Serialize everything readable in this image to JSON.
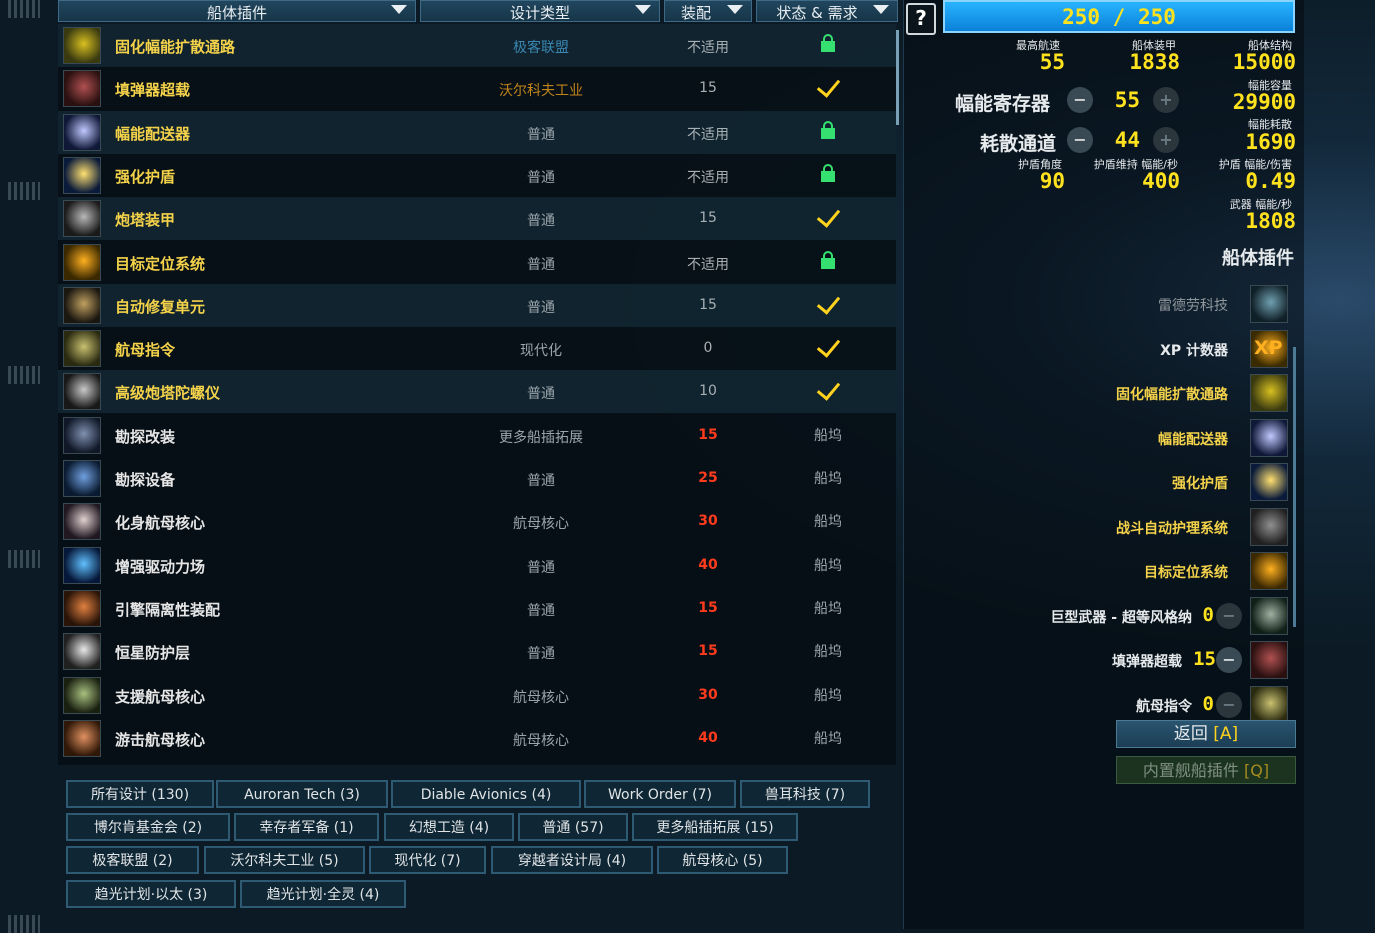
{
  "header": {
    "col_name": "船体插件",
    "col_type": "设计类型",
    "col_equip": "装配",
    "col_status": "状态 & 需求",
    "help_label": "?"
  },
  "rows": [
    {
      "name": "固化幅能扩散通路",
      "type": "极客联盟",
      "equip": "不适用",
      "status": "lock",
      "icon": "flux-conduit-icon"
    },
    {
      "name": "填弹器超载",
      "type": "沃尔科夫工业",
      "equip": "15",
      "status": "check",
      "icon": "autoloader-icon"
    },
    {
      "name": "幅能配送器",
      "type": "普通",
      "equip": "不适用",
      "status": "lock",
      "icon": "flux-distributor-icon"
    },
    {
      "name": "强化护盾",
      "type": "普通",
      "equip": "不适用",
      "status": "lock",
      "icon": "shield-icon"
    },
    {
      "name": "炮塔装甲",
      "type": "普通",
      "equip": "15",
      "status": "check",
      "icon": "turret-armor-icon"
    },
    {
      "name": "目标定位系统",
      "type": "普通",
      "equip": "不适用",
      "status": "lock",
      "icon": "targeting-icon"
    },
    {
      "name": "自动修复单元",
      "type": "普通",
      "equip": "15",
      "status": "check",
      "icon": "repair-unit-icon"
    },
    {
      "name": "航母指令",
      "type": "现代化",
      "equip": "0",
      "status": "check",
      "icon": "carrier-command-icon"
    },
    {
      "name": "高级炮塔陀螺仪",
      "type": "普通",
      "equip": "10",
      "status": "check",
      "icon": "gyro-icon"
    },
    {
      "name": "勘探改装",
      "type": "更多船插拓展",
      "equip": "15",
      "status": "船坞",
      "icon": "survey-icon"
    },
    {
      "name": "勘探设备",
      "type": "普通",
      "equip": "25",
      "status": "船坞",
      "icon": "survey-equipment-icon"
    },
    {
      "name": "化身航母核心",
      "type": "航母核心",
      "equip": "30",
      "status": "船坞",
      "icon": "avatar-core-icon"
    },
    {
      "name": "增强驱动力场",
      "type": "普通",
      "equip": "40",
      "status": "船坞",
      "icon": "drive-field-icon"
    },
    {
      "name": "引擎隔离性装配",
      "type": "普通",
      "equip": "15",
      "status": "船坞",
      "icon": "engine-isolation-icon"
    },
    {
      "name": "恒星防护层",
      "type": "普通",
      "equip": "15",
      "status": "船坞",
      "icon": "solar-shield-icon"
    },
    {
      "name": "支援航母核心",
      "type": "航母核心",
      "equip": "30",
      "status": "船坞",
      "icon": "support-core-icon"
    },
    {
      "name": "游击航母核心",
      "type": "航母核心",
      "equip": "40",
      "status": "船坞",
      "icon": "raider-core-icon"
    }
  ],
  "filters": [
    [
      "所有设计 (130)",
      "Auroran Tech (3)",
      "Diable Avionics (4)",
      "Work Order (7)",
      "兽耳科技 (7)"
    ],
    [
      "博尔肯基金会 (2)",
      "幸存者军备 (1)",
      "幻想工造 (4)",
      "普通 (57)",
      "更多船插拓展 (15)"
    ],
    [
      "极客联盟 (2)",
      "沃尔科夫工业 (5)",
      "现代化 (7)",
      "穿越者设计局 (4)",
      "航母核心 (5)"
    ],
    [
      "趋光计划·以太 (3)",
      "趋光计划·全灵 (4)"
    ]
  ],
  "stats": {
    "op": "250 / 250",
    "max_speed_label": "最高航速",
    "max_speed": "55",
    "armor_label": "船体装甲",
    "armor": "1838",
    "hull_label": "船体结构",
    "hull": "15000",
    "flux_cap_label": "幅能容量",
    "flux_cap": "29900",
    "capacitors_label": "幅能寄存器",
    "capacitors": "55",
    "flux_diss_label": "幅能耗散",
    "flux_diss": "1690",
    "vents_label": "耗散通道",
    "vents": "44",
    "shield_arc_label": "护盾角度",
    "shield_arc": "90",
    "shield_upkeep_label": "护盾维持 幅能/秒",
    "shield_upkeep": "400",
    "shield_eff_label": "护盾 幅能/伤害",
    "shield_eff": "0.49",
    "weapon_flux_label": "武器 幅能/秒",
    "weapon_flux": "1808",
    "minus": "−",
    "plus": "+"
  },
  "installed": {
    "title": "船体插件",
    "items": [
      {
        "name": "雷德劳科技",
        "style": "gray",
        "icon": "redlaw-tech-icon"
      },
      {
        "name": "XP 计数器",
        "style": "wh",
        "icon": "xp-counter-icon",
        "icon_text": "XP"
      },
      {
        "name": "固化幅能扩散通路",
        "style": "y",
        "icon": "flux-conduit-icon"
      },
      {
        "name": "幅能配送器",
        "style": "y",
        "icon": "flux-distributor-icon"
      },
      {
        "name": "强化护盾",
        "style": "y",
        "icon": "shield-icon"
      },
      {
        "name": "战斗自动护理系统",
        "style": "y",
        "icon": "combat-repair-icon"
      },
      {
        "name": "目标定位系统",
        "style": "y",
        "icon": "targeting-icon"
      },
      {
        "name": "巨型武器 - 超等风格纳",
        "style": "wh",
        "icon": "superweapon-icon",
        "value": "0"
      },
      {
        "name": "填弹器超载",
        "style": "wh",
        "icon": "autoloader-icon",
        "value": "15"
      },
      {
        "name": "航母指令",
        "style": "wh",
        "icon": "carrier-command-icon",
        "value": "0"
      }
    ]
  },
  "buttons": {
    "back": "返回",
    "back_key": "[A]",
    "builtin": "内置舰船插件",
    "builtin_key": "[Q]"
  }
}
